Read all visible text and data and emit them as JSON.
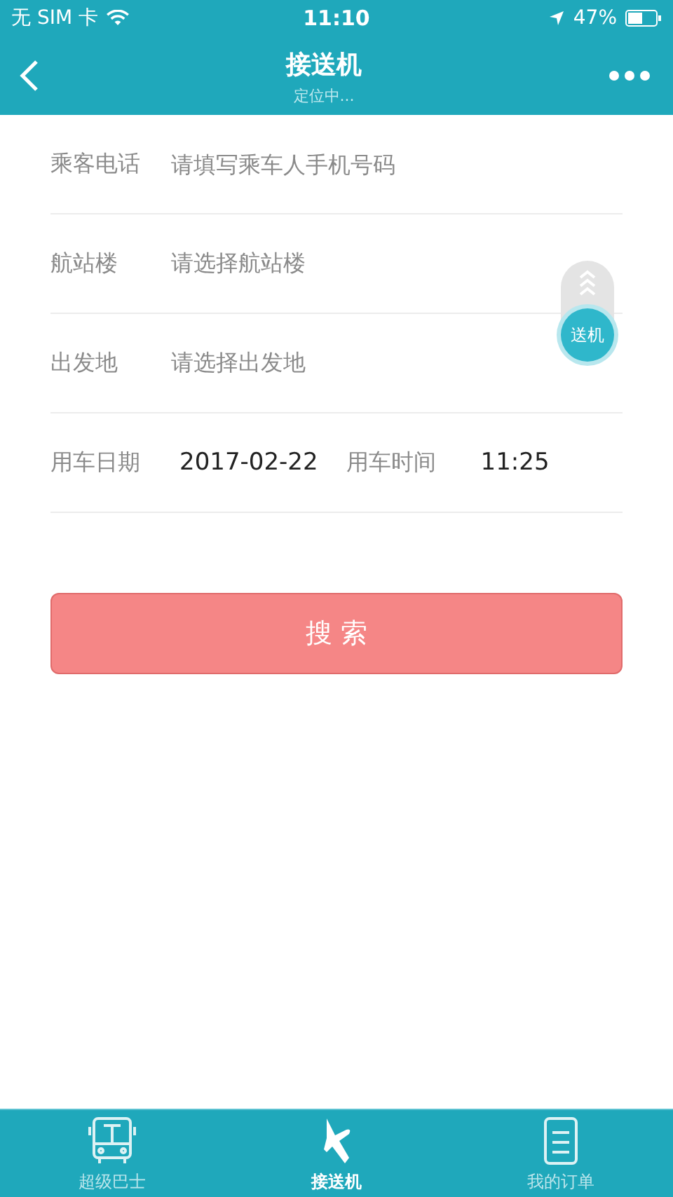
{
  "status_bar": {
    "carrier": "无 SIM 卡",
    "time": "11:10",
    "battery": "47%"
  },
  "nav": {
    "title": "接送机",
    "subtitle": "定位中..."
  },
  "fields": [
    {
      "kind": "input",
      "label": "乘客电话",
      "placeholder": "请填写乘车人手机号码"
    },
    {
      "kind": "select",
      "label": "航站楼",
      "placeholder": "请选择航站楼"
    },
    {
      "kind": "select",
      "label": "出发地",
      "placeholder": "请选择出发地"
    },
    {
      "kind": "datetime",
      "label": "用车日期",
      "value": "2017-02-22",
      "label_2": "用车时间",
      "value_2": "11:25"
    }
  ],
  "toggle": {
    "label": "送机"
  },
  "search_button": "搜 索",
  "tabs": [
    {
      "label": "超级巴士",
      "kind": "bus",
      "selected": false
    },
    {
      "label": "接送机",
      "kind": "plane",
      "selected": true
    },
    {
      "label": "我的订单",
      "kind": "list",
      "selected": false
    }
  ]
}
